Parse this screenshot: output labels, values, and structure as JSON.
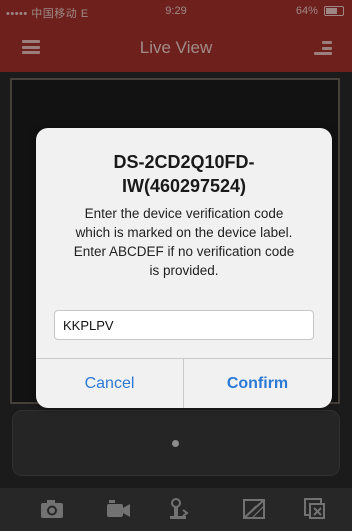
{
  "status_bar": {
    "carrier": "••••• 中国移动 E",
    "time": "9:29",
    "battery": "64%"
  },
  "nav": {
    "title": "Live View"
  },
  "dialog": {
    "title_line1": "DS-2CD2Q10FD-",
    "title_line2": "IW(460297524)",
    "message_line1": "Enter the device verification code",
    "message_line2": "which is marked on the device label.",
    "message_line3": "Enter ABCDEF if no verification code",
    "message_line4": "is provided.",
    "input_value": "KKPLPV",
    "cancel_label": "Cancel",
    "confirm_label": "Confirm"
  },
  "toolbar": {
    "icons": [
      "camera-icon",
      "video-record-icon",
      "ptz-icon",
      "image-quality-icon",
      "close-window-icon"
    ]
  },
  "colors": {
    "brand": "#a9322c",
    "link": "#2a7ad6"
  }
}
